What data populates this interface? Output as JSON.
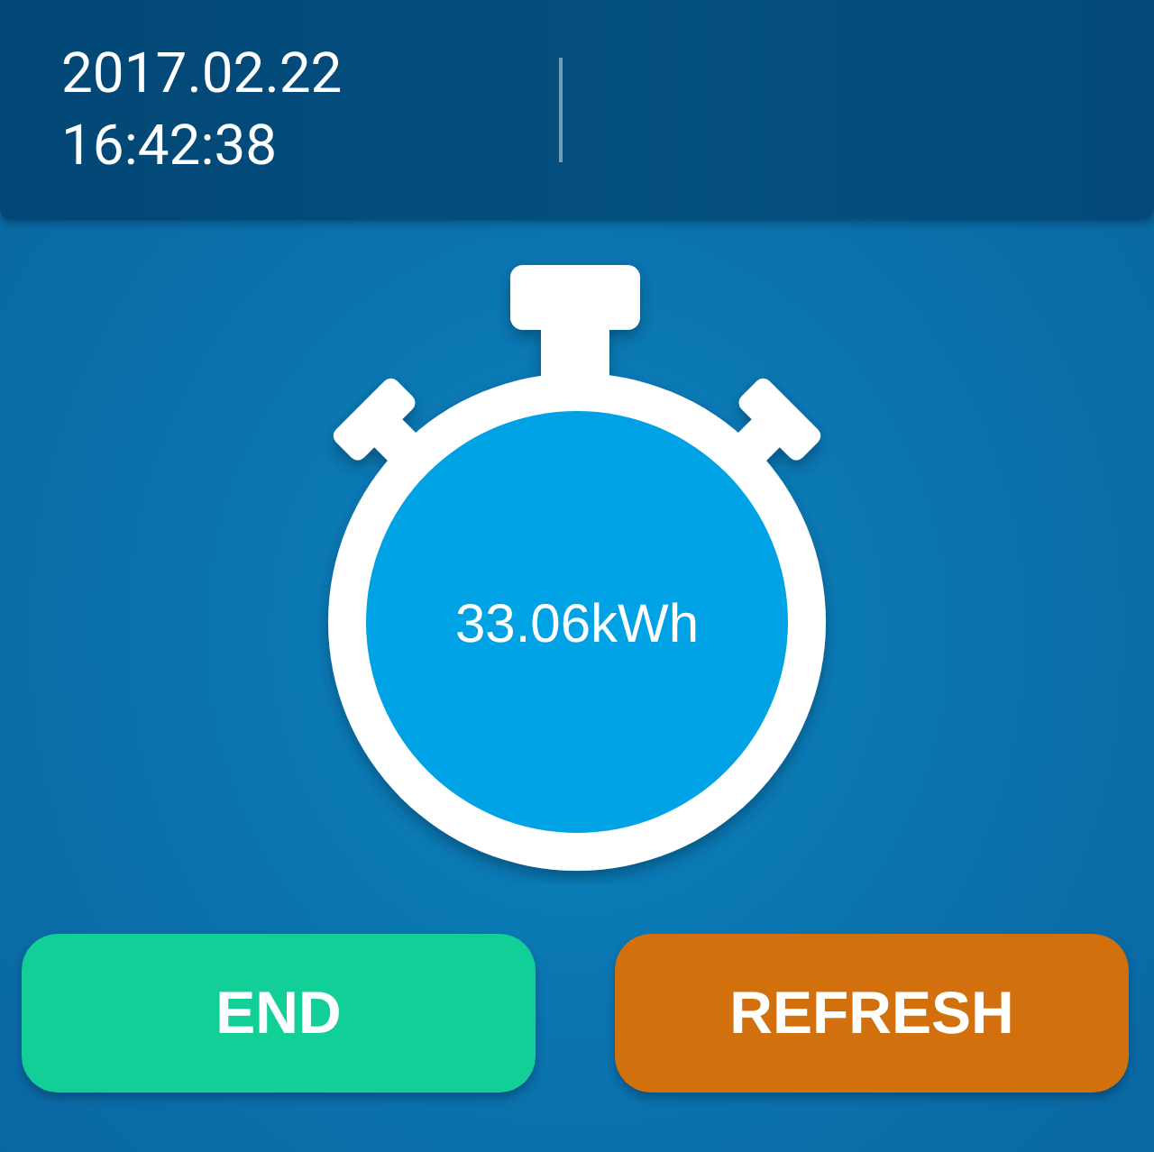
{
  "header": {
    "date": "2017.02.22",
    "time": "16:42:38"
  },
  "stopwatch": {
    "reading": "33.06kWh"
  },
  "buttons": [
    {
      "label": "END",
      "kind": "end"
    },
    {
      "label": "REFRESH",
      "kind": "refresh"
    }
  ]
}
